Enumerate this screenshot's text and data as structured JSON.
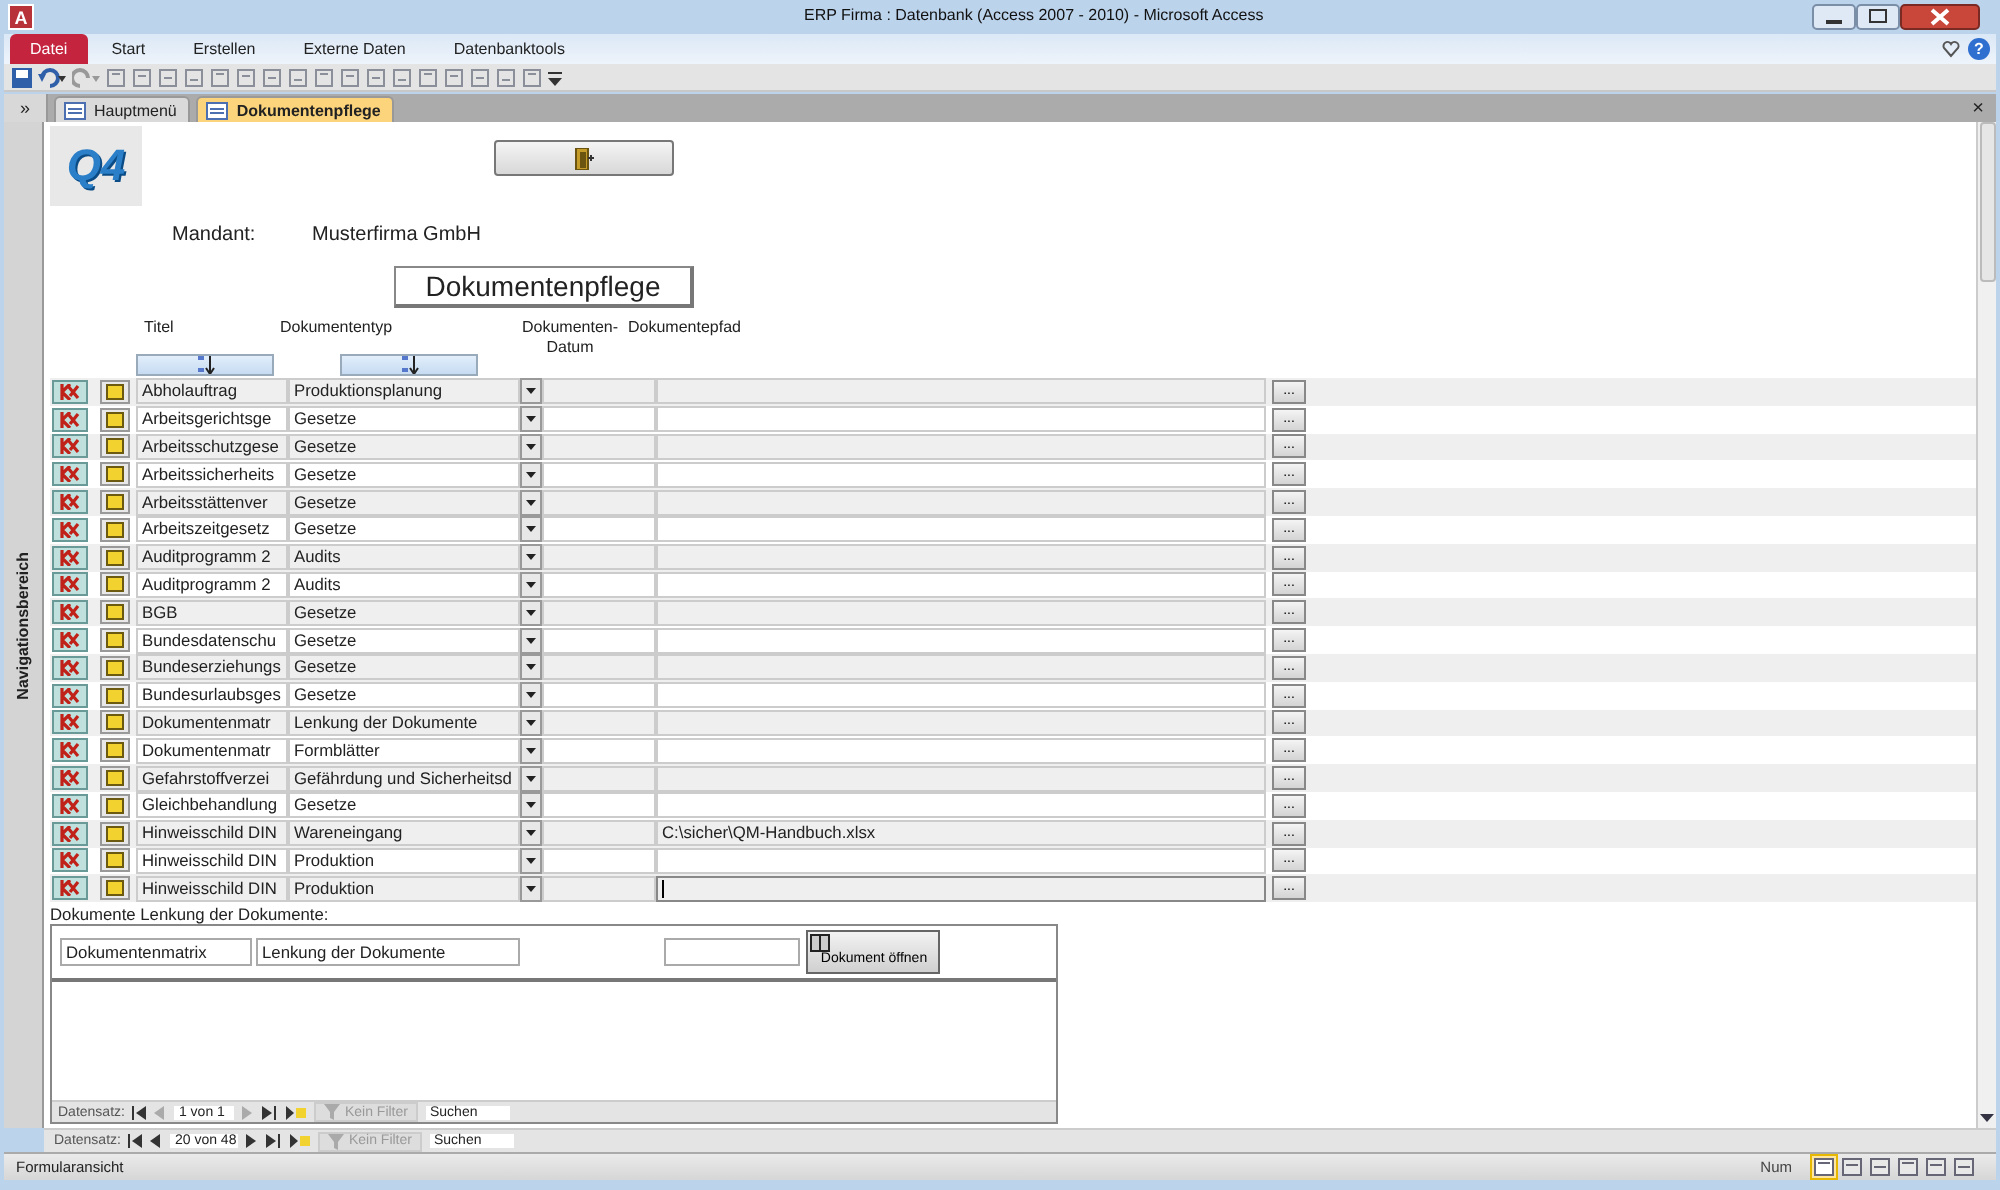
{
  "window": {
    "title": "ERP Firma : Datenbank (Access 2007 - 2010)  -  Microsoft Access",
    "app_icon": "A"
  },
  "ribbon": {
    "tabs": [
      {
        "label": "Datei",
        "selected": true
      },
      {
        "label": "Start",
        "selected": false
      },
      {
        "label": "Erstellen",
        "selected": false
      },
      {
        "label": "Externe Daten",
        "selected": false
      },
      {
        "label": "Datenbanktools",
        "selected": false
      }
    ],
    "help": "?"
  },
  "doc_tabs": [
    {
      "label": "Hauptmenü",
      "selected": false
    },
    {
      "label": "Dokumentenpflege",
      "selected": true
    }
  ],
  "doc_close": "×",
  "nav_pane": {
    "toggle": "»",
    "label": "Navigationsbereich"
  },
  "form": {
    "logo": "Q4",
    "mandant_label": "Mandant:",
    "mandant": "Musterfirma GmbH",
    "heading": "Dokumentenpflege",
    "columns": [
      "Titel",
      "Dokumententyp",
      "Dokumenten-Datum",
      "Dokumentepfad"
    ],
    "rows": [
      {
        "title": "Abholauftrag",
        "type": "Produktionsplanung",
        "browse": "...",
        "focused": false
      },
      {
        "title": "Arbeitsgerichtsge",
        "type": "Gesetze",
        "browse": "...",
        "focused": false
      },
      {
        "title": "Arbeitsschutzgese",
        "type": "Gesetze",
        "browse": "...",
        "focused": false
      },
      {
        "title": "Arbeitssicherheits",
        "type": "Gesetze",
        "browse": "...",
        "focused": false
      },
      {
        "title": "Arbeitsstättenver",
        "type": "Gesetze",
        "browse": "...",
        "focused": false
      },
      {
        "title": "Arbeitszeitgesetz",
        "type": "Gesetze",
        "browse": "...",
        "focused": false
      },
      {
        "title": "Auditprogramm 2",
        "type": "Audits",
        "browse": "...",
        "focused": false
      },
      {
        "title": "Auditprogramm 2",
        "type": "Audits",
        "browse": "...",
        "focused": false
      },
      {
        "title": "BGB",
        "type": "Gesetze",
        "browse": "...",
        "focused": false
      },
      {
        "title": "Bundesdatenschu",
        "type": "Gesetze",
        "browse": "...",
        "focused": false
      },
      {
        "title": "Bundeserziehungs",
        "type": "Gesetze",
        "browse": "...",
        "focused": false
      },
      {
        "title": "Bundesurlaubsges",
        "type": "Gesetze",
        "browse": "...",
        "focused": false
      },
      {
        "title": "Dokumentenmatr",
        "type": "Lenkung der Dokumente",
        "browse": "...",
        "focused": false
      },
      {
        "title": "Dokumentenmatr",
        "type": "Formblätter",
        "browse": "...",
        "focused": false
      },
      {
        "title": "Gefahrstoffverzei",
        "type": "Gefährdung und Sicherheitsd",
        "browse": "...",
        "focused": false
      },
      {
        "title": "Gleichbehandlung",
        "type": "Gesetze",
        "browse": "...",
        "focused": false
      },
      {
        "title": "Hinweisschild DIN",
        "type": "Wareneingang",
        "path": "C:\\sicher\\QM-Handbuch.xlsx",
        "browse": "...",
        "focused": false
      },
      {
        "title": "Hinweisschild DIN",
        "type": "Produktion",
        "browse": "...",
        "focused": false
      },
      {
        "title": "Hinweisschild DIN",
        "type": "Produktion",
        "browse": "...",
        "focused": true
      }
    ]
  },
  "subform": {
    "label": "Dokumente Lenkung der Dokumente:",
    "fields": [
      "Dokumentenmatrix",
      "Lenkung der Dokumente"
    ],
    "open_button": "Dokument öffnen",
    "nav": {
      "label": "Datensatz:",
      "position": "1 von 1",
      "filter": "Kein Filter",
      "search": "Suchen"
    }
  },
  "record_nav": {
    "label": "Datensatz:",
    "position": "20 von 48",
    "filter": "Kein Filter",
    "search": "Suchen"
  },
  "status_bar": {
    "text": "Formularansicht",
    "num": "Num",
    "views": [
      {
        "selected": true
      },
      {
        "selected": false
      },
      {
        "selected": false
      },
      {
        "selected": false
      },
      {
        "selected": false
      },
      {
        "selected": false
      }
    ]
  }
}
